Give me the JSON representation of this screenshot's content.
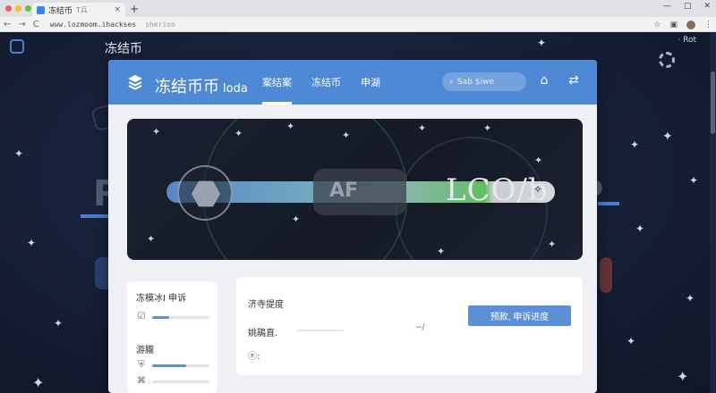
{
  "browser": {
    "tab_title": "冻结币",
    "tab_subtitle": "T兵",
    "tab_close": "×",
    "new_tab": "+",
    "url": "www.lozmoom.ihackses",
    "url_ghost": "sherioo",
    "nav_back": "←",
    "nav_forward": "→",
    "nav_reload": "C",
    "win_min": "—",
    "win_max": "□",
    "win_close": "✕",
    "menu_dots": "⋮"
  },
  "background": {
    "title": "冻结币",
    "right_label": "· Rot",
    "big_left": "Ro",
    "big_mid": "AF",
    "big_right": "P"
  },
  "app": {
    "brand": "冻结币币",
    "brand_suffix": "loda",
    "nav": [
      "案结案",
      "冻结币",
      "申湖"
    ],
    "search_placeholder": "Sab $iwe"
  },
  "hero": {
    "progress": 0.82,
    "chip_text": "AF",
    "code": "LCO/b"
  },
  "left_panel": {
    "title": "冻模冰I 申诉",
    "section2": "游朧",
    "rows": [
      {
        "icon": "check-badge-icon",
        "fill": 0.3
      },
      {
        "icon": "shield-icon",
        "fill": 0.6
      },
      {
        "icon": "tag-icon",
        "fill": 0
      }
    ]
  },
  "right_panel": {
    "title": "济寺提度",
    "label": "姚鵑直.",
    "mark": "~/",
    "icon_text": "ⓔ:",
    "button_label": "预款, 申诉进度"
  },
  "colors": {
    "accent": "#4f88d4",
    "button": "#5b8fd6",
    "progress_green": "#5fbf62"
  }
}
